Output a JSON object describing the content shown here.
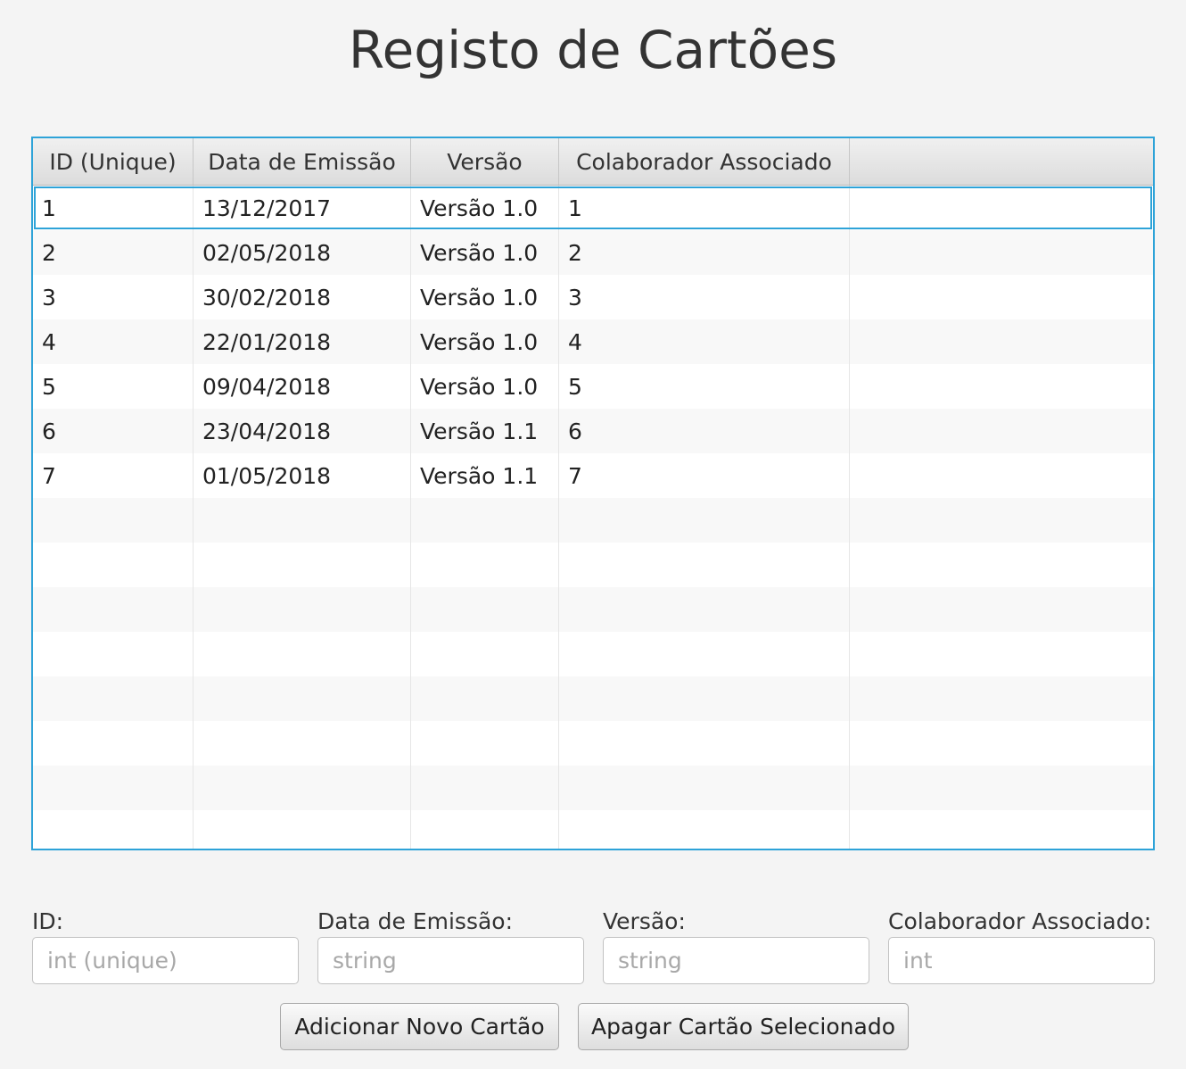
{
  "window": {
    "title": "Registo de Cartões"
  },
  "table": {
    "columns": [
      "ID (Unique)",
      "Data de Emissão",
      "Versão",
      "Colaborador Associado"
    ],
    "rows": [
      [
        "1",
        "13/12/2017",
        "Versão 1.0",
        "1"
      ],
      [
        "2",
        "02/05/2018",
        "Versão 1.0",
        "2"
      ],
      [
        "3",
        "30/02/2018",
        "Versão 1.0",
        "3"
      ],
      [
        "4",
        "22/01/2018",
        "Versão 1.0",
        "4"
      ],
      [
        "5",
        "09/04/2018",
        "Versão 1.0",
        "5"
      ],
      [
        "6",
        "23/04/2018",
        "Versão 1.1",
        "6"
      ],
      [
        "7",
        "01/05/2018",
        "Versão 1.1",
        "7"
      ]
    ],
    "selected_row": 0,
    "accent_color": "#2ea3d8"
  },
  "form": {
    "id_label": "ID:",
    "id_placeholder": "int (unique)",
    "date_label": "Data de Emissão:",
    "date_placeholder": "string",
    "version_label": "Versão:",
    "version_placeholder": "string",
    "collaborator_label": "Colaborador Associado:",
    "collaborator_placeholder": "int"
  },
  "buttons": {
    "add_label": "Adicionar Novo Cartão",
    "delete_label": "Apagar Cartão Selecionado"
  }
}
